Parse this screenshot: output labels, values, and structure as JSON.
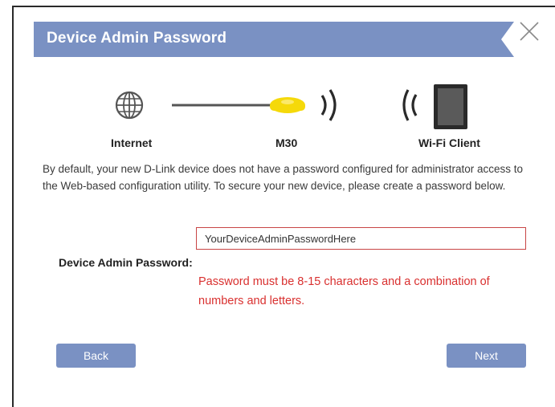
{
  "dialog": {
    "title": "Device Admin Password"
  },
  "topology": {
    "internet_label": "Internet",
    "device_label": "M30",
    "client_label": "Wi-Fi Client"
  },
  "description": "By default, your new D-Link device does not have a password configured for administrator access to the Web-based configuration utility. To secure your new device, please create a password below.",
  "password_field": {
    "label": "Device Admin Password:",
    "value": "YourDeviceAdminPasswordHere",
    "error": "Password must be 8-15 characters and a combination of numbers and letters."
  },
  "buttons": {
    "back_label": "Back",
    "next_label": "Next"
  },
  "colors": {
    "header": "#7a91c3",
    "button": "#7a91c3",
    "error": "#d9302f",
    "device_yellow": "#f5d90a",
    "input_border": "#c84545"
  }
}
